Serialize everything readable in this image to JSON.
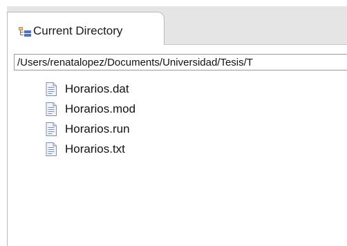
{
  "tab": {
    "label": "Current Directory",
    "icon": "directory-tree-icon"
  },
  "path": {
    "value": "/Users/renatalopez/Documents/Universidad/Tesis/T"
  },
  "files": [
    {
      "name": "Horarios.dat",
      "icon": "text-file-icon"
    },
    {
      "name": "Horarios.mod",
      "icon": "text-file-icon"
    },
    {
      "name": "Horarios.run",
      "icon": "text-file-icon"
    },
    {
      "name": "Horarios.txt",
      "icon": "text-file-icon"
    }
  ],
  "colors": {
    "icon_blue": "#4a74c9",
    "icon_orange": "#d98a2b",
    "file_page": "#f2f4f8",
    "file_lines": "#7a8fb8"
  }
}
